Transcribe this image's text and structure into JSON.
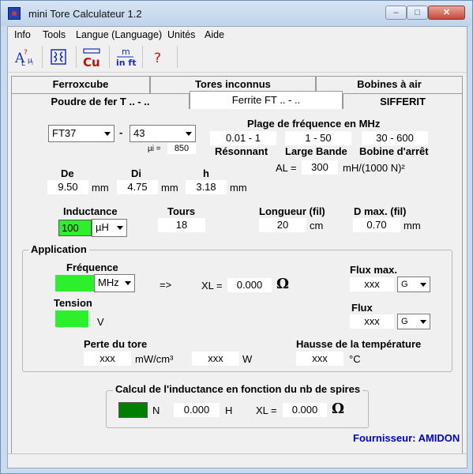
{
  "window": {
    "title": "mini Tore Calculateur 1.2",
    "min": "–",
    "max": "□",
    "close": "✕"
  },
  "menu": [
    "Info",
    "Tools",
    "Langue (Language)",
    "Unités",
    "Aide"
  ],
  "tabs": {
    "row1": [
      "Ferroxcube",
      "Tores inconnus",
      "Bobines à air"
    ],
    "row2": [
      "Poudre de fer T .. - ..",
      "Ferrite FT .. - ..",
      "SIFFERIT"
    ]
  },
  "core": {
    "type": "FT37",
    "mix": "43",
    "dash": "-",
    "mu_label": "µi =",
    "mu_value": "850"
  },
  "freq": {
    "title": "Plage de fréquence en MHz",
    "ranges": [
      "0.01 - 1",
      "1 - 50",
      "30 - 600"
    ],
    "labels": [
      "Résonnant",
      "Large Bande",
      "Bobine d'arrêt"
    ]
  },
  "al": {
    "label": "AL =",
    "value": "300",
    "unit": "mH/(1000 N)²"
  },
  "dims": {
    "headers": [
      "De",
      "Di",
      "h"
    ],
    "values": [
      "9.50",
      "4.75",
      "3.18"
    ],
    "unit": "mm"
  },
  "inductance": {
    "label": "Inductance",
    "value": "100",
    "unit": "µH"
  },
  "tours": {
    "label": "Tours",
    "value": "18"
  },
  "longueur": {
    "label": "Longueur (fil)",
    "value": "20",
    "unit": "cm"
  },
  "dmax": {
    "label": "D max. (fil)",
    "value": "0.70",
    "unit": "mm"
  },
  "application": {
    "title": "Application",
    "freq_label": "Fréquence",
    "freq_unit": "MHz",
    "arrow": "=>",
    "xl_label": "XL =",
    "xl_value": "0.000",
    "ohm": "Ω",
    "tension_label": "Tension",
    "tension_unit": "V",
    "fluxmax_label": "Flux max.",
    "fluxmax_value": "xxx",
    "fluxmax_unit": "G",
    "flux_label": "Flux",
    "flux_value": "xxx",
    "flux_unit": "G",
    "perte_label": "Perte du tore",
    "perte_value1": "xxx",
    "perte_unit1": "mW/cm³",
    "perte_value2": "xxx",
    "perte_unit2": "W",
    "hausse_label": "Hausse de la température",
    "hausse_value": "xxx",
    "hausse_unit": "°C"
  },
  "calc": {
    "title": "Calcul de l'inductance en fonction du nb de spires",
    "n_label": "N",
    "h_value": "0.000",
    "h_unit": "H",
    "xl_label": "XL =",
    "xl_value": "0.000",
    "ohm": "Ω"
  },
  "supplier": "Fournisseur: AMIDON",
  "colors": {
    "green": "#2df02d",
    "dark_green": "#008000",
    "supplier": "#0000cc"
  }
}
